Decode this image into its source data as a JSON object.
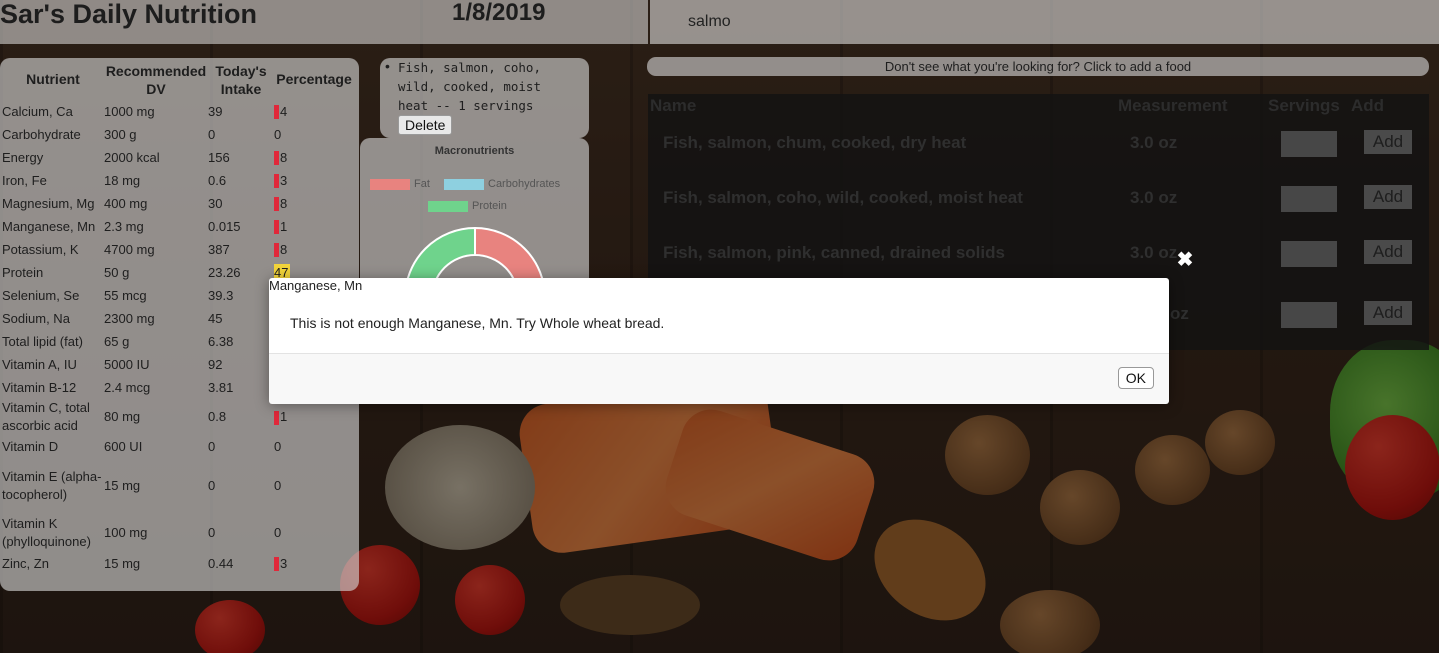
{
  "header": {
    "title": "Sar's Daily Nutrition",
    "date": "1/8/2019",
    "search_value": "salmo"
  },
  "nutrients": {
    "columns": [
      "Nutrient",
      "Recommended DV",
      "Today's Intake",
      "Percentage"
    ],
    "rows": [
      {
        "name": "Calcium, Ca",
        "dv": "1000 mg",
        "intake": "39",
        "pct": "4",
        "status": "low"
      },
      {
        "name": "Carbohydrate",
        "dv": "300 g",
        "intake": "0",
        "pct": "0",
        "status": "none"
      },
      {
        "name": "Energy",
        "dv": "2000 kcal",
        "intake": "156",
        "pct": "8",
        "status": "low"
      },
      {
        "name": "Iron, Fe",
        "dv": "18 mg",
        "intake": "0.6",
        "pct": "3",
        "status": "low"
      },
      {
        "name": "Magnesium, Mg",
        "dv": "400 mg",
        "intake": "30",
        "pct": "8",
        "status": "low"
      },
      {
        "name": "Manganese, Mn",
        "dv": "2.3 mg",
        "intake": "0.015",
        "pct": "1",
        "status": "low"
      },
      {
        "name": "Potassium, K",
        "dv": "4700 mg",
        "intake": "387",
        "pct": "8",
        "status": "low"
      },
      {
        "name": "Protein",
        "dv": "50 g",
        "intake": "23.26",
        "pct": "47",
        "status": "mid"
      },
      {
        "name": "Selenium, Se",
        "dv": "55 mcg",
        "intake": "39.3",
        "pct": "",
        "status": "none"
      },
      {
        "name": "Sodium, Na",
        "dv": "2300 mg",
        "intake": "45",
        "pct": "",
        "status": "none"
      },
      {
        "name": "Total lipid (fat)",
        "dv": "65 g",
        "intake": "6.38",
        "pct": "",
        "status": "none"
      },
      {
        "name": "Vitamin A, IU",
        "dv": "5000 IU",
        "intake": "92",
        "pct": "",
        "status": "none"
      },
      {
        "name": "Vitamin B-12",
        "dv": "2.4 mcg",
        "intake": "3.81",
        "pct": "",
        "status": "none"
      },
      {
        "name": "Vitamin C, total ascorbic acid",
        "dv": "80 mg",
        "intake": "0.8",
        "pct": "1",
        "status": "low"
      },
      {
        "name": "Vitamin D",
        "dv": "600 UI",
        "intake": "0",
        "pct": "0",
        "status": "none"
      },
      {
        "name": "Vitamin E (alpha-tocopherol)",
        "dv": "15 mg",
        "intake": "0",
        "pct": "0",
        "status": "none"
      },
      {
        "name": "Vitamin K (phylloquinone)",
        "dv": "100 mg",
        "intake": "0",
        "pct": "0",
        "status": "none"
      },
      {
        "name": "Zinc, Zn",
        "dv": "15 mg",
        "intake": "0.44",
        "pct": "3",
        "status": "low"
      }
    ]
  },
  "meal": {
    "items": [
      {
        "text": "Fish, salmon, coho, wild, cooked, moist heat -- 1 servings",
        "delete_label": "Delete"
      }
    ]
  },
  "macro_chart": {
    "title": "Macronutrients",
    "legend": [
      {
        "name": "Fat",
        "color": "#e8837f"
      },
      {
        "name": "Carbohydrates",
        "color": "#8ed0e0"
      },
      {
        "name": "Protein",
        "color": "#6fd38c"
      }
    ]
  },
  "food_search": {
    "add_food_prompt": "Don't see what you're looking for? Click to add a food",
    "columns": [
      "Name",
      "Measurement",
      "Servings",
      "Add"
    ],
    "results": [
      {
        "name": "Fish, salmon, chum, cooked, dry heat",
        "measurement": "3.0 oz",
        "add_label": "Add"
      },
      {
        "name": "Fish, salmon, coho, wild, cooked, moist heat",
        "measurement": "3.0 oz",
        "add_label": "Add"
      },
      {
        "name": "Fish, salmon, pink, canned, drained solids",
        "measurement": "3.0 oz",
        "add_label": "Add"
      },
      {
        "name": "",
        "measurement": "oz",
        "add_label": "Add"
      }
    ]
  },
  "modal": {
    "title": "Manganese, Mn",
    "message": "This is not enough Manganese, Mn. Try Whole wheat bread.",
    "ok_label": "OK",
    "close_glyph": "✖"
  },
  "colors": {
    "low_bar": "#e0283a",
    "mid_bar": "#f2d43a"
  }
}
